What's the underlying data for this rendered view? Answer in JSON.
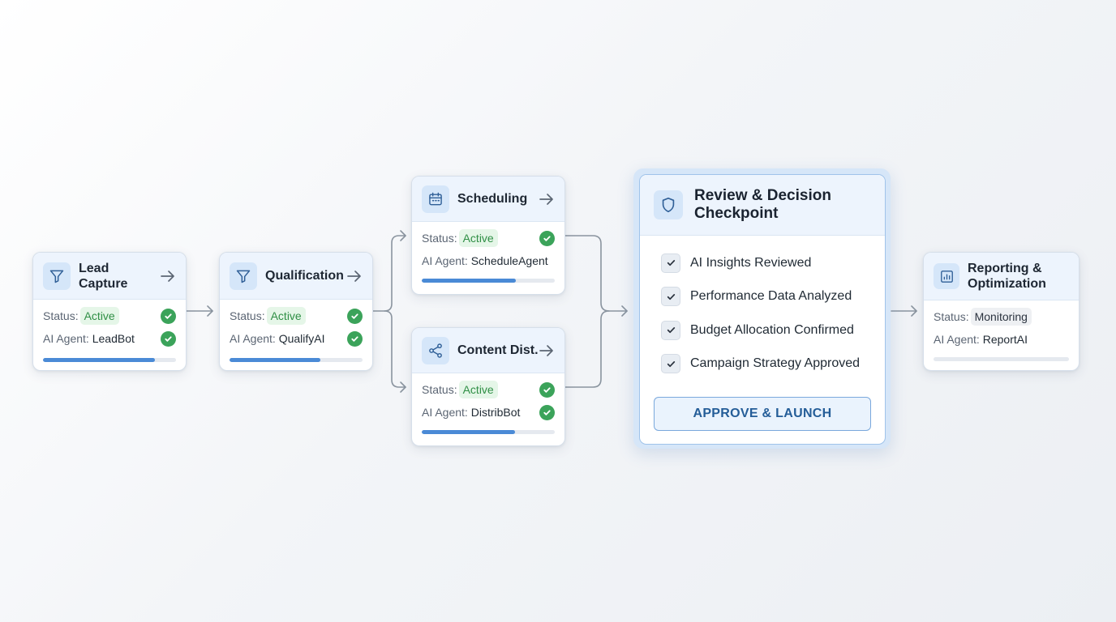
{
  "stages": {
    "lead_capture": {
      "title": "Lead Capture",
      "status_label": "Status:",
      "status": "Active",
      "agent_label": "AI Agent:",
      "agent": "LeadBot",
      "progress": 0.84,
      "icon": "funnel-icon"
    },
    "qualification": {
      "title": "Qualification",
      "status_label": "Status:",
      "status": "Active",
      "agent_label": "AI Agent:",
      "agent": "QualifyAI",
      "progress": 0.68,
      "icon": "funnel-icon"
    },
    "scheduling": {
      "title": "Scheduling",
      "status_label": "Status:",
      "status": "Active",
      "agent_label": "AI Agent:",
      "agent": "ScheduleAgent",
      "progress": 0.71,
      "icon": "calendar-icon"
    },
    "content_dist": {
      "title": "Content Dist.",
      "status_label": "Status:",
      "status": "Active",
      "agent_label": "AI Agent:",
      "agent": "DistribBot",
      "progress": 0.7,
      "icon": "share-icon"
    },
    "reporting": {
      "title_line1": "Reporting &",
      "title_line2": "Optimization",
      "status_label": "Status:",
      "status": "Monitoring",
      "agent_label": "AI Agent:",
      "agent": "ReportAI",
      "progress": 0.0,
      "icon": "chart-icon"
    }
  },
  "review": {
    "title_line1": "Review & Decision",
    "title_line2": "Checkpoint",
    "icon": "shield-icon",
    "checklist": [
      "AI Insights Reviewed",
      "Performance Data Analyzed",
      "Budget Allocation Confirmed",
      "Campaign Strategy Approved"
    ],
    "approve_label": "APPROVE & LAUNCH"
  },
  "colors": {
    "accent": "#4a8ad6",
    "success": "#3ba35a",
    "header_bg": "#edf4fd"
  }
}
